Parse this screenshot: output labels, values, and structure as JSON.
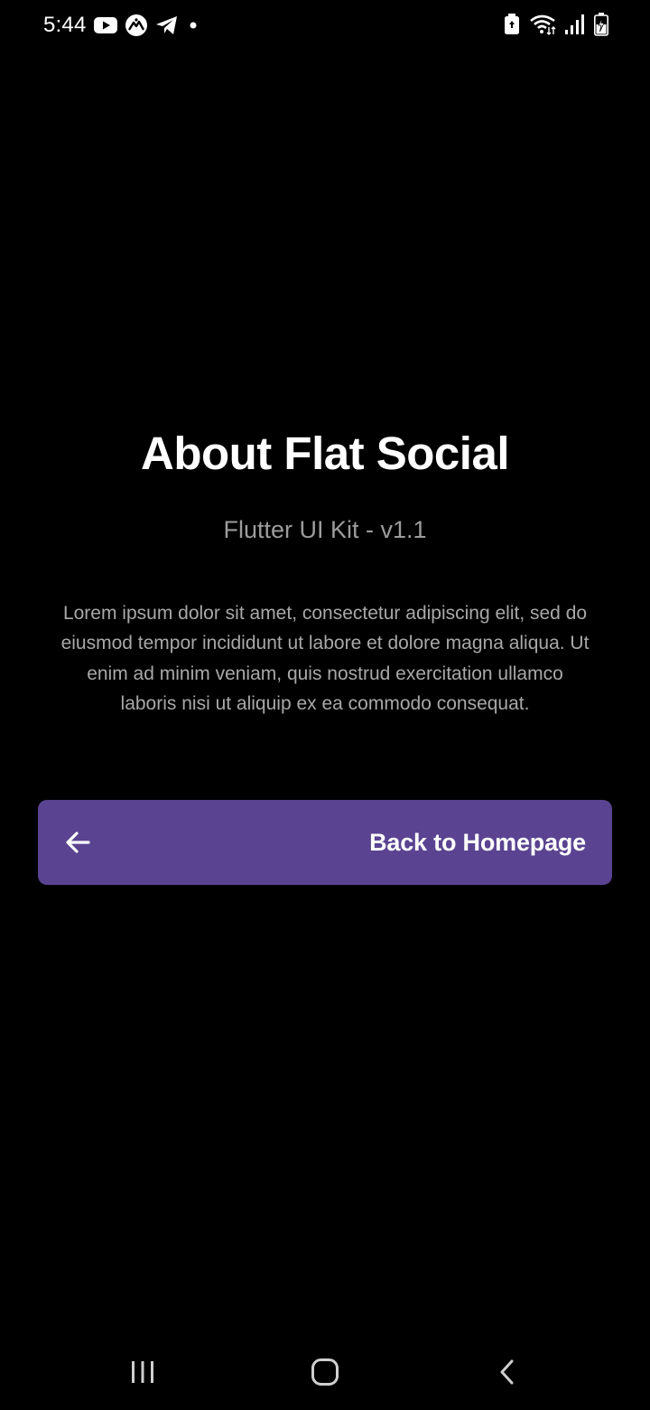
{
  "status_bar": {
    "time": "5:44",
    "left_icons": [
      "youtube-icon",
      "app-icon",
      "telegram-icon",
      "dot-icon"
    ],
    "right_icons": [
      "battery-saver-icon",
      "wifi-icon",
      "signal-icon",
      "battery-icon"
    ]
  },
  "about": {
    "title": "About Flat Social",
    "subtitle": "Flutter UI Kit - v1.1",
    "body": "Lorem ipsum dolor sit amet, consectetur adipiscing elit, sed do eiusmod tempor incididunt ut labore et dolore magna aliqua. Ut enim ad minim veniam, quis nostrud exercitation ullamco laboris nisi ut aliquip ex ea commodo consequat."
  },
  "back_button": {
    "label": "Back to Homepage",
    "icon": "arrow-left-icon",
    "color": "#5a4391"
  },
  "nav_bar": {
    "icons": [
      "recents-icon",
      "home-icon",
      "back-icon"
    ]
  },
  "colors": {
    "background": "#000000",
    "title": "#ffffff",
    "subtitle": "#9c9c9c",
    "body": "#a8a8a8",
    "accent": "#5a4391"
  }
}
